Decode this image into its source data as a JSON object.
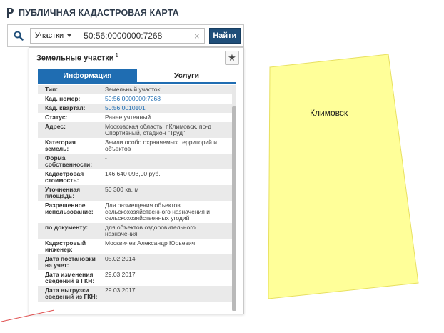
{
  "header": {
    "title": "ПУБЛИЧНАЯ КАДАСТРОВАЯ КАРТА"
  },
  "search": {
    "layer": "Участки",
    "query": "50:56:0000000:7268",
    "find_label": "Найти"
  },
  "panel": {
    "title": "Земельные участки",
    "count": "1",
    "tabs": [
      {
        "label": "Информация",
        "active": true
      },
      {
        "label": "Услуги",
        "active": false
      }
    ],
    "rows": [
      {
        "key": "Тип:",
        "value": "Земельный участок"
      },
      {
        "key": "Кад. номер:",
        "value": "50:56:0000000:7268",
        "link": true
      },
      {
        "key": "Кад. квартал:",
        "value": "50:56:0010101",
        "link": true
      },
      {
        "key": "Статус:",
        "value": "Ранее учтенный"
      },
      {
        "key": "Адрес:",
        "value": "Московская область, г.Климовск, пр-д Спортивный, стадион \"Труд\""
      },
      {
        "key": "Категория земель:",
        "value": "Земли особо охраняемых территорий и объектов"
      },
      {
        "key": "Форма собственности:",
        "value": "-"
      },
      {
        "key": "Кадастровая стоимость:",
        "value": "146 640 093,00 руб."
      },
      {
        "key": "Уточненная площадь:",
        "value": "50 300 кв. м"
      },
      {
        "key": "Разрешенное использование:",
        "value": "Для размещения объектов сельскохозяйственного назначения и сельскохозяйственных угодий"
      },
      {
        "key": "по документу:",
        "value": "для объектов оздоровительного назначения"
      },
      {
        "key": "Кадастровый инженер:",
        "value": "Москвичев Александр Юрьевич"
      },
      {
        "key": "Дата постановки на учет:",
        "value": "05.02.2014"
      },
      {
        "key": "Дата изменения сведений в ГКН:",
        "value": "29.03.2017"
      },
      {
        "key": "Дата выгрузки сведений из ГКН:",
        "value": "29.03.2017"
      }
    ]
  },
  "map": {
    "label": "Климовск",
    "parcel_color": "#ffff99",
    "parcel_stroke": "#e8e060"
  },
  "colors": {
    "accent": "#1f6db2",
    "button": "#1f4e79"
  },
  "icons": {
    "logo": "pkk-logo-icon",
    "search": "search-icon",
    "clear": "clear-icon",
    "favorite": "star-icon"
  }
}
